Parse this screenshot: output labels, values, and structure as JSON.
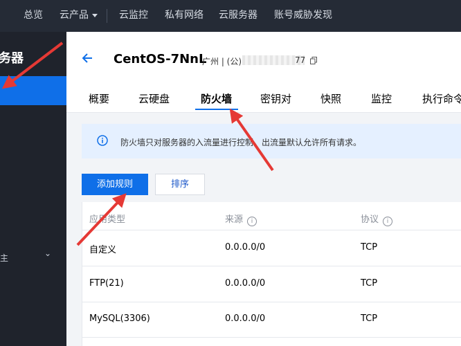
{
  "topnav": {
    "overview": "总览",
    "products": "云产品",
    "monitor": "云监控",
    "private_network": "私有网络",
    "cloud_server": "云服务器",
    "account_threat": "账号威胁发现"
  },
  "sidebar": {
    "title": "务器",
    "collapsed_item": "主"
  },
  "instance": {
    "name": "CentOS-7NnL",
    "region_prefix": "广州 | (公)",
    "region_suffix": "77"
  },
  "tabs": [
    {
      "label": "概要"
    },
    {
      "label": "云硬盘"
    },
    {
      "label": "防火墙"
    },
    {
      "label": "密钥对"
    },
    {
      "label": "快照"
    },
    {
      "label": "监控"
    },
    {
      "label": "执行命令"
    }
  ],
  "notice": {
    "text": "防火墙只对服务器的入流量进行控制，出流量默认允许所有请求。"
  },
  "actions": {
    "add_rule": "添加规则",
    "sort": "排序"
  },
  "table": {
    "headers": [
      "应用类型",
      "来源",
      "协议"
    ],
    "rows": [
      {
        "app": "自定义",
        "source": "0.0.0.0/0",
        "protocol": "TCP"
      },
      {
        "app": "FTP(21)",
        "source": "0.0.0.0/0",
        "protocol": "TCP"
      },
      {
        "app": "MySQL(3306)",
        "source": "0.0.0.0/0",
        "protocol": "TCP"
      }
    ]
  },
  "colors": {
    "accent": "#0f6fe8",
    "topbar": "#252b36",
    "sidebar": "#1f232c",
    "annotation_arrow": "#e53935"
  }
}
